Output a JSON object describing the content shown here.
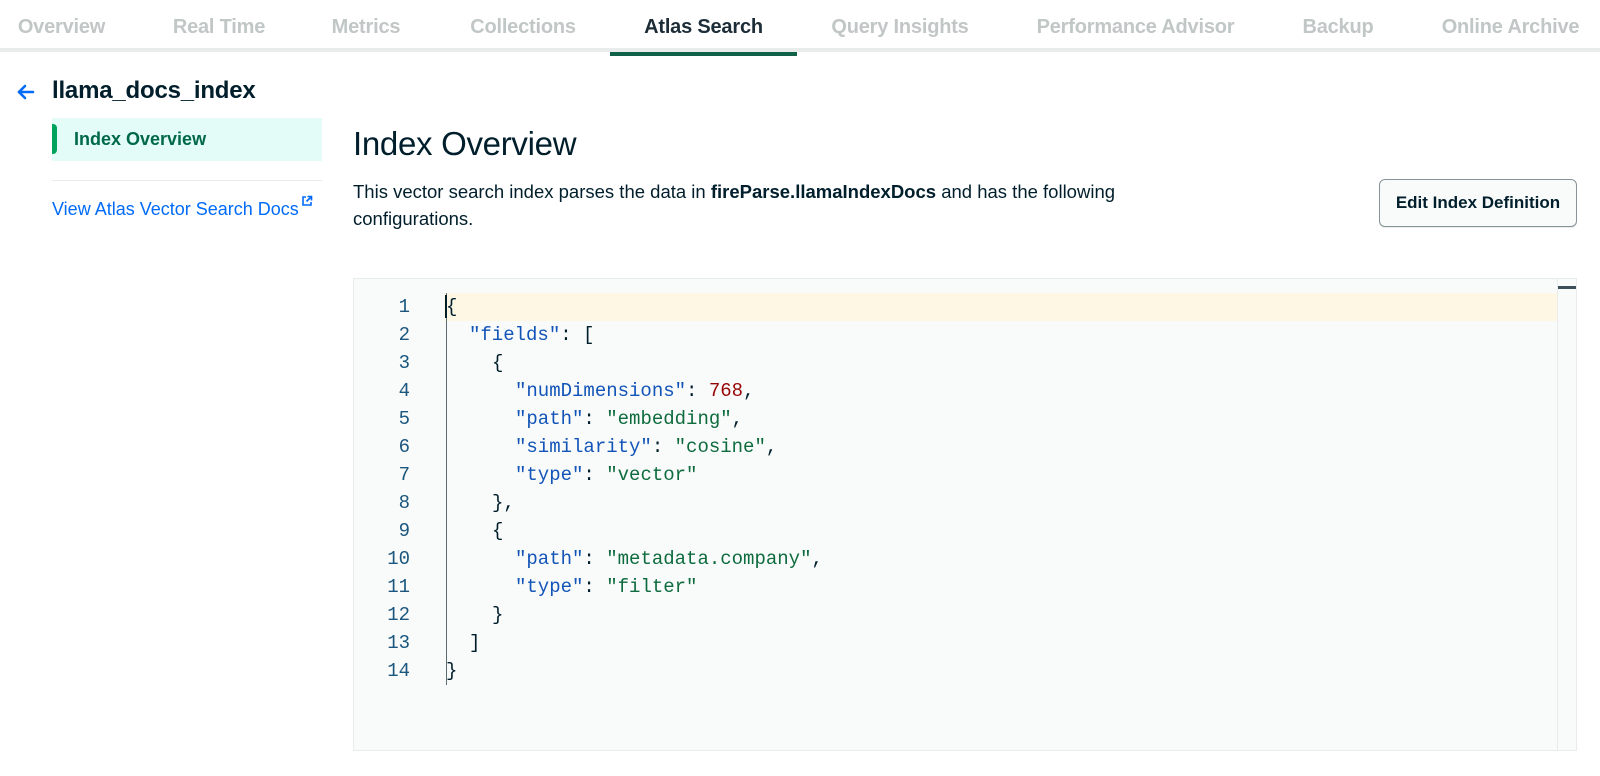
{
  "tabs": [
    {
      "label": "Overview",
      "active": false
    },
    {
      "label": "Real Time",
      "active": false
    },
    {
      "label": "Metrics",
      "active": false
    },
    {
      "label": "Collections",
      "active": false
    },
    {
      "label": "Atlas Search",
      "active": true
    },
    {
      "label": "Query Insights",
      "active": false
    },
    {
      "label": "Performance Advisor",
      "active": false
    },
    {
      "label": "Backup",
      "active": false
    },
    {
      "label": "Online Archive",
      "active": false
    }
  ],
  "sidebar": {
    "index_name": "llama_docs_index",
    "nav_item": "Index Overview",
    "docs_link": "View Atlas Vector Search Docs"
  },
  "main": {
    "heading": "Index Overview",
    "description_prefix": "This vector search index parses the data in ",
    "description_namespace": "fireParse.llamaIndexDocs",
    "description_suffix": " and has the following configurations.",
    "edit_button": "Edit Index Definition"
  },
  "editor": {
    "current_line": 1,
    "lines": [
      {
        "n": "1",
        "indent": 0,
        "tokens": [
          {
            "t": "punc",
            "v": "{"
          }
        ]
      },
      {
        "n": "2",
        "indent": 1,
        "tokens": [
          {
            "t": "key",
            "v": "\"fields\""
          },
          {
            "t": "punc",
            "v": ": ["
          }
        ]
      },
      {
        "n": "3",
        "indent": 2,
        "tokens": [
          {
            "t": "punc",
            "v": "{"
          }
        ]
      },
      {
        "n": "4",
        "indent": 3,
        "tokens": [
          {
            "t": "key",
            "v": "\"numDimensions\""
          },
          {
            "t": "punc",
            "v": ": "
          },
          {
            "t": "num",
            "v": "768"
          },
          {
            "t": "punc",
            "v": ","
          }
        ]
      },
      {
        "n": "5",
        "indent": 3,
        "tokens": [
          {
            "t": "key",
            "v": "\"path\""
          },
          {
            "t": "punc",
            "v": ": "
          },
          {
            "t": "str",
            "v": "\"embedding\""
          },
          {
            "t": "punc",
            "v": ","
          }
        ]
      },
      {
        "n": "6",
        "indent": 3,
        "tokens": [
          {
            "t": "key",
            "v": "\"similarity\""
          },
          {
            "t": "punc",
            "v": ": "
          },
          {
            "t": "str",
            "v": "\"cosine\""
          },
          {
            "t": "punc",
            "v": ","
          }
        ]
      },
      {
        "n": "7",
        "indent": 3,
        "tokens": [
          {
            "t": "key",
            "v": "\"type\""
          },
          {
            "t": "punc",
            "v": ": "
          },
          {
            "t": "str",
            "v": "\"vector\""
          }
        ]
      },
      {
        "n": "8",
        "indent": 2,
        "tokens": [
          {
            "t": "punc",
            "v": "},"
          }
        ]
      },
      {
        "n": "9",
        "indent": 2,
        "tokens": [
          {
            "t": "punc",
            "v": "{"
          }
        ]
      },
      {
        "n": "10",
        "indent": 3,
        "tokens": [
          {
            "t": "key",
            "v": "\"path\""
          },
          {
            "t": "punc",
            "v": ": "
          },
          {
            "t": "str",
            "v": "\"metadata.company\""
          },
          {
            "t": "punc",
            "v": ","
          }
        ]
      },
      {
        "n": "11",
        "indent": 3,
        "tokens": [
          {
            "t": "key",
            "v": "\"type\""
          },
          {
            "t": "punc",
            "v": ": "
          },
          {
            "t": "str",
            "v": "\"filter\""
          }
        ]
      },
      {
        "n": "12",
        "indent": 2,
        "tokens": [
          {
            "t": "punc",
            "v": "}"
          }
        ]
      },
      {
        "n": "13",
        "indent": 1,
        "tokens": [
          {
            "t": "punc",
            "v": "]"
          }
        ]
      },
      {
        "n": "14",
        "indent": 0,
        "tokens": [
          {
            "t": "punc",
            "v": "}"
          }
        ]
      }
    ]
  },
  "colors": {
    "active_tab_underline": "#116149",
    "nav_active_bg": "#e3fcf7",
    "nav_active_bar": "#00a35c",
    "link": "#016bf8",
    "json_key": "#1254b7",
    "json_string": "#0e6b3e",
    "json_number": "#970606"
  },
  "icons": {
    "back": "arrow-left-icon",
    "external_link": "external-link-icon"
  }
}
